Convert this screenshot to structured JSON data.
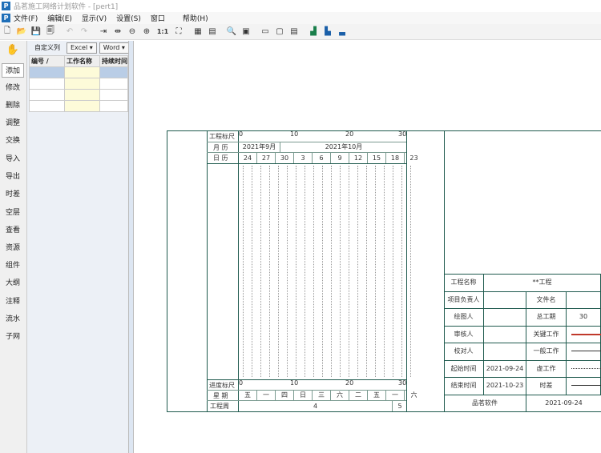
{
  "app": {
    "title": "品茗施工网络计划软件 - [pert1]"
  },
  "menu": [
    "文件(F)",
    "编辑(E)",
    "显示(V)",
    "设置(S)",
    "窗口",
    "帮助(H)"
  ],
  "toolbar_icons": [
    "new-icon",
    "open-icon",
    "save-icon",
    "save-as-icon",
    "undo-icon",
    "redo-icon",
    "fit-width-icon",
    "fit-height-icon",
    "zoom-out-icon",
    "zoom-in-icon",
    "actual-size-icon",
    "full-screen-icon",
    "grid-view-icon",
    "calculator-icon",
    "print-preview-icon",
    "print-icon",
    "page-setup-icon",
    "view-mode-a-icon",
    "view-mode-b-icon",
    "chart-a-icon",
    "chart-b-icon",
    "chart-c-icon"
  ],
  "toolbar_actual_size": "1:1",
  "leftnav": [
    "添加",
    "修改",
    "删除",
    "调整",
    "交换",
    "导入",
    "导出",
    "时差",
    "空层",
    "查看",
    "资源",
    "组件",
    "大纲",
    "注释",
    "流水",
    "子网"
  ],
  "grid": {
    "buttons": {
      "custom": "自定义列",
      "excel": "Excel",
      "word": "Word"
    },
    "headers": [
      "编号",
      "工作名称",
      "持续时间"
    ]
  },
  "timeline": {
    "scale_label": "工程标尺",
    "month_label": "月 历",
    "day_label": "日 历",
    "progress_label": "进度标尺",
    "week_label": "星 期",
    "workweek_label": "工程周",
    "scale_ticks": [
      "0",
      "10",
      "20",
      "30"
    ],
    "months": [
      "2021年9月",
      "2021年10月"
    ],
    "days": [
      "24",
      "27",
      "30",
      "3",
      "6",
      "9",
      "12",
      "15",
      "18",
      "23"
    ],
    "weekdays": [
      "五",
      "一",
      "四",
      "日",
      "三",
      "六",
      "二",
      "五",
      "一",
      "六"
    ],
    "workweeks": [
      "4",
      "5"
    ]
  },
  "info": {
    "rows": [
      [
        "工程名称",
        "**工程",
        "",
        ""
      ],
      [
        "项目负责人",
        "",
        "文件名",
        ""
      ],
      [
        "绘图人",
        "",
        "总工期",
        "30"
      ],
      [
        "审核人",
        "",
        "关键工作",
        ""
      ],
      [
        "校对人",
        "",
        "一般工作",
        ""
      ],
      [
        "起始时间",
        "2021-09-24",
        "虚工作",
        ""
      ],
      [
        "结束时间",
        "2021-10-23",
        "时差",
        ""
      ]
    ],
    "footer_company": "品茗软件",
    "footer_date": "2021-09-24"
  },
  "colors": {
    "frame": "#1f5a4e",
    "key_line": "#c0392b"
  }
}
